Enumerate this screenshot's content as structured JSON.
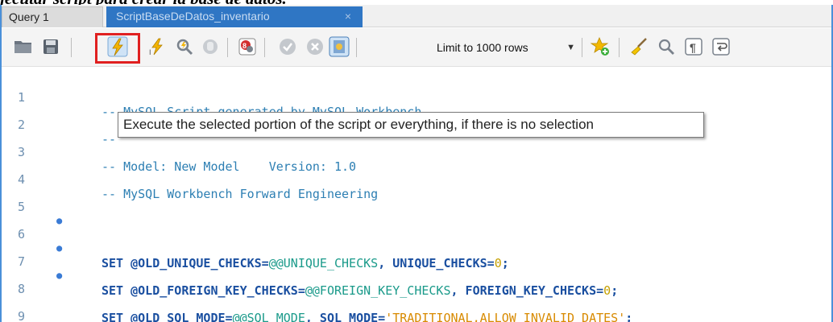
{
  "caption": "jecutar script para crear la base de datos.",
  "tabs": [
    {
      "label": "Query 1",
      "active": true
    },
    {
      "label": "ScriptBaseDeDatos_inventario",
      "active": false,
      "close": "×"
    }
  ],
  "toolbar": {
    "limit_label": "Limit to 1000 rows",
    "tooltip": "Execute the selected portion of the script or everything, if there is no selection"
  },
  "editor": {
    "lines": [
      {
        "num": "1",
        "text": "-- MySQL Script generated by MySQL Workbench"
      },
      {
        "num": "2",
        "text": "-- "
      },
      {
        "num": "3",
        "text": "-- Model: New Model    Version: 1.0"
      },
      {
        "num": "4",
        "text": "-- MySQL Workbench Forward Engineering"
      },
      {
        "num": "5",
        "text": ""
      },
      {
        "num": "6",
        "kw": "SET",
        "var": "@OLD_UNIQUE_CHECKS=",
        "sys": "@@UNIQUE_CHECKS",
        "rest": ", UNIQUE_CHECKS=",
        "val": "0",
        "end": ";"
      },
      {
        "num": "7",
        "kw": "SET",
        "var": "@OLD_FOREIGN_KEY_CHECKS=",
        "sys": "@@FOREIGN_KEY_CHECKS",
        "rest": ", FOREIGN_KEY_CHECKS=",
        "val": "0",
        "end": ";"
      },
      {
        "num": "8",
        "kw": "SET",
        "var": "@OLD_SQL_MODE=",
        "sys": "@@SQL_MODE",
        "rest": ", SQL_MODE=",
        "val": "'TRADITIONAL,ALLOW_INVALID_DATES'",
        "end": ";"
      },
      {
        "num": "9",
        "text": ""
      }
    ],
    "marker": "●"
  },
  "colors": {
    "tab_active_bg": "#dcdcdc",
    "tab_inactive_bg": "#2f76c4",
    "highlight": "#e02020",
    "comment": "#2d7fb3",
    "keyword": "#1a4fa0",
    "string": "#d88a00"
  }
}
